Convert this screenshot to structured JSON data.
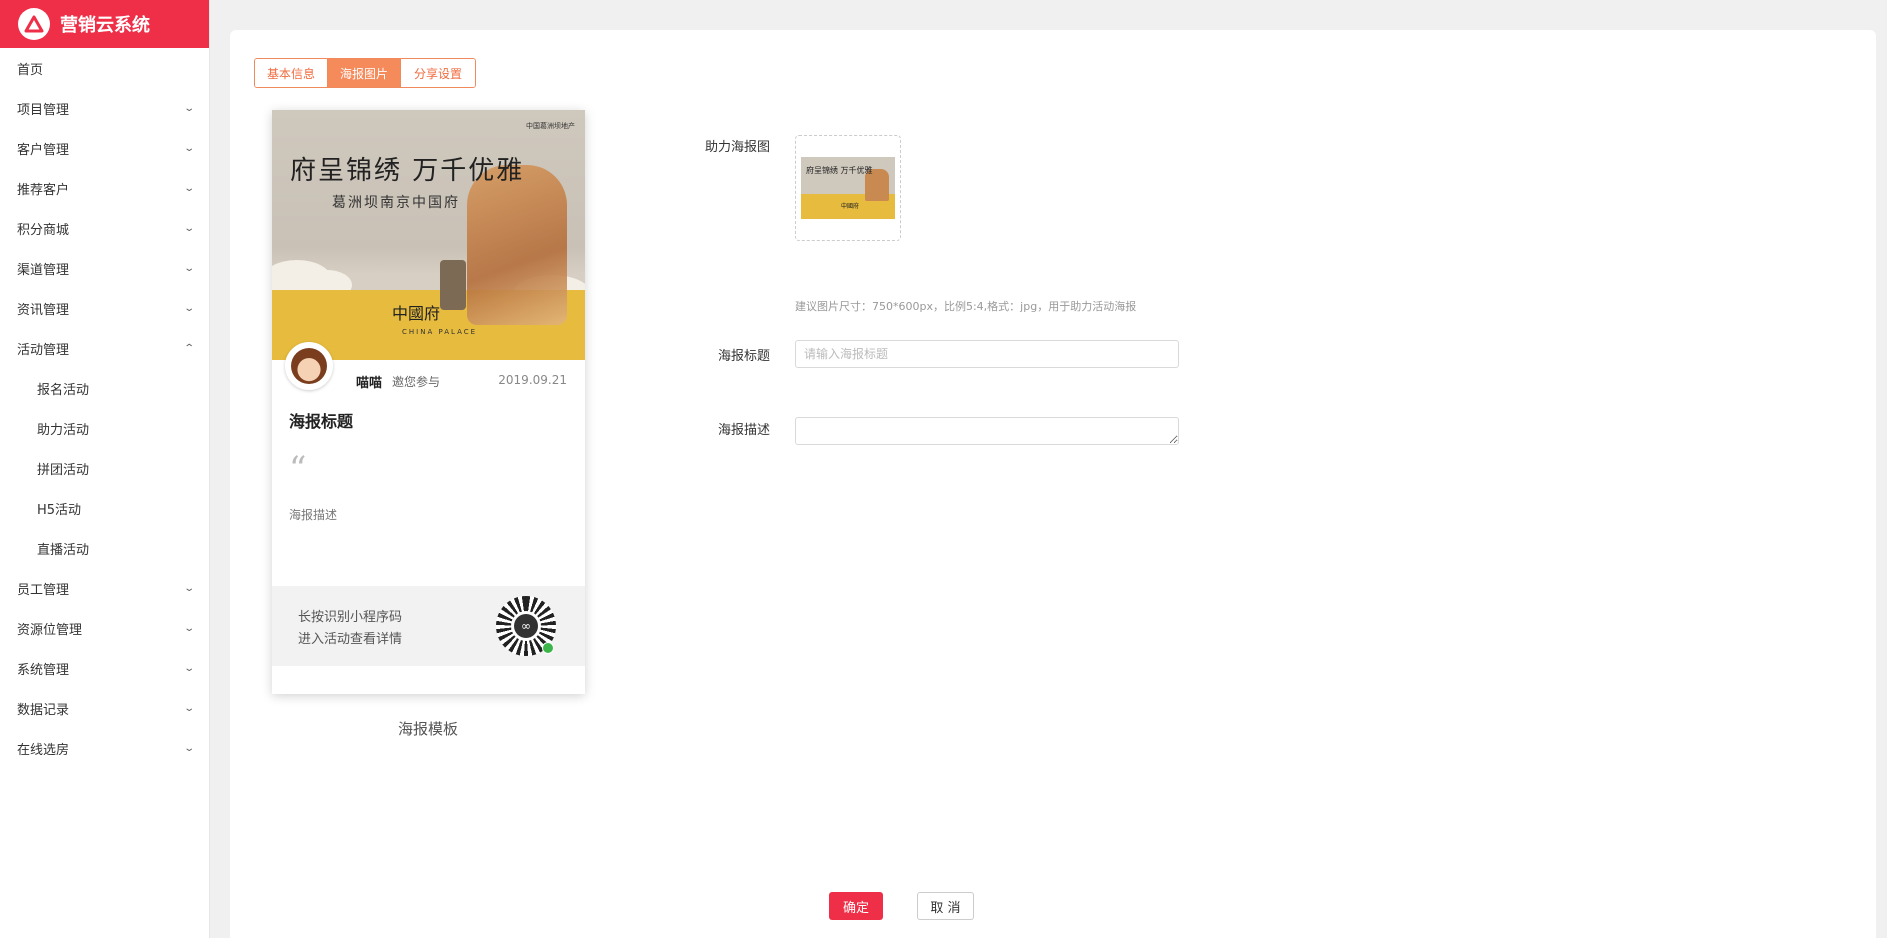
{
  "app": {
    "title": "营销云系统"
  },
  "sidebar": {
    "items": [
      {
        "label": "首页",
        "has_children": false
      },
      {
        "label": "项目管理",
        "has_children": true
      },
      {
        "label": "客户管理",
        "has_children": true
      },
      {
        "label": "推荐客户",
        "has_children": true
      },
      {
        "label": "积分商城",
        "has_children": true
      },
      {
        "label": "渠道管理",
        "has_children": true
      },
      {
        "label": "资讯管理",
        "has_children": true
      },
      {
        "label": "活动管理",
        "has_children": true,
        "expanded": true
      },
      {
        "label": "员工管理",
        "has_children": true
      },
      {
        "label": "资源位管理",
        "has_children": true
      },
      {
        "label": "系统管理",
        "has_children": true
      },
      {
        "label": "数据记录",
        "has_children": true
      },
      {
        "label": "在线选房",
        "has_children": true
      }
    ],
    "activity_submenu": [
      "报名活动",
      "助力活动",
      "拼团活动",
      "H5活动",
      "直播活动"
    ]
  },
  "tabs": [
    {
      "label": "基本信息",
      "active": false
    },
    {
      "label": "海报图片",
      "active": true
    },
    {
      "label": "分享设置",
      "active": false
    }
  ],
  "poster": {
    "image": {
      "headline": "府呈锦绣 万千优雅",
      "subheadline": "葛洲坝南京中国府",
      "corner_text": "中国葛洲坝地产",
      "brand": "中國府",
      "brand_en": "CHINA PALACE"
    },
    "nickname": "喵喵",
    "invite_text": "邀您参与",
    "date": "2019.09.21",
    "title": "海报标题",
    "quote_mark": "“",
    "description": "海报描述",
    "footer_line1": "长按识别小程序码",
    "footer_line2": "进入活动查看详情",
    "template_label": "海报模板"
  },
  "form": {
    "poster_image_label": "助力海报图",
    "hint": "建议图片尺寸：750*600px，比例5:4,格式：jpg，用于助力活动海报",
    "title_label": "海报标题",
    "title_placeholder": "请输入海报标题",
    "title_value": "",
    "desc_label": "海报描述",
    "desc_value": ""
  },
  "actions": {
    "confirm": "确定",
    "cancel": "取 消"
  },
  "colors": {
    "brand": "#ef2f48",
    "tab_active": "#f58a5b",
    "poster_yellow": "#e6bb3e"
  },
  "icons": {
    "logo": "triangle-logo-icon",
    "chevron": "chevron-down-icon",
    "qr": "mini-program-code-icon"
  }
}
